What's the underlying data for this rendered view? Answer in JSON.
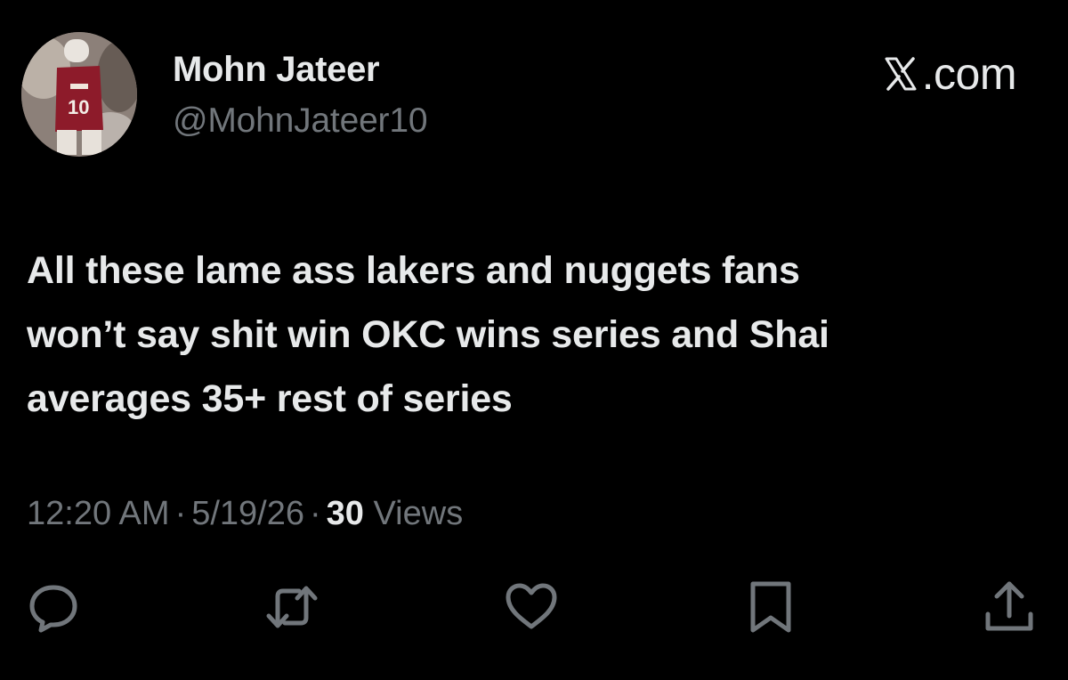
{
  "author": {
    "display_name": "Mohn Jateer",
    "handle": "@MohnJateer10",
    "avatar_jersey_number": "10"
  },
  "brand": {
    "label": ".com",
    "logo_icon": "x-logo-icon"
  },
  "tweet": {
    "lines": [
      "All these lame ass lakers and nuggets fans",
      "won’t say shit win OKC wins series and Shai",
      "averages 35+ rest of series"
    ]
  },
  "meta": {
    "time": "12:20 AM",
    "date": "5/19/26",
    "separator": "·",
    "views_count": "30",
    "views_label": "Views"
  },
  "actions": {
    "items": [
      "reply-icon",
      "retweet-icon",
      "like-icon",
      "bookmark-icon",
      "share-icon"
    ]
  },
  "colors": {
    "background": "#000000",
    "primary_text": "#e7e9ea",
    "secondary_text": "#71767b",
    "icon": "#71767b"
  }
}
